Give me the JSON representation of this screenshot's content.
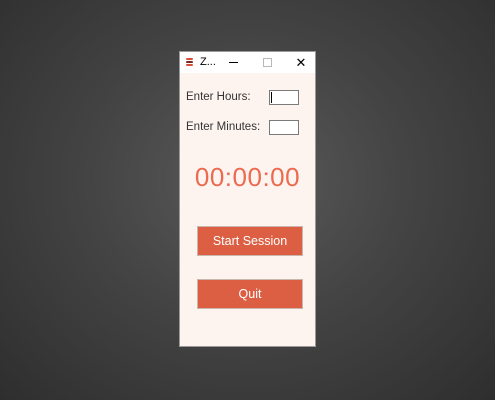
{
  "window": {
    "title": "Z...",
    "controls": {
      "minimize_glyph": "",
      "maximize_glyph": "",
      "close_glyph": "✕"
    }
  },
  "form": {
    "hours_label": "Enter Hours:",
    "hours_value": "",
    "minutes_label": "Enter Minutes:",
    "minutes_value": ""
  },
  "timer": {
    "display": "00:00:00"
  },
  "buttons": {
    "start_label": "Start Session",
    "quit_label": "Quit"
  },
  "colors": {
    "accent": "#dc5f44",
    "timer_text": "#ec6a50",
    "window_bg": "#fdf4ef"
  },
  "icons": {
    "app": "app-icon",
    "minimize": "minimize-icon",
    "maximize": "maximize-icon",
    "close": "close-icon"
  }
}
